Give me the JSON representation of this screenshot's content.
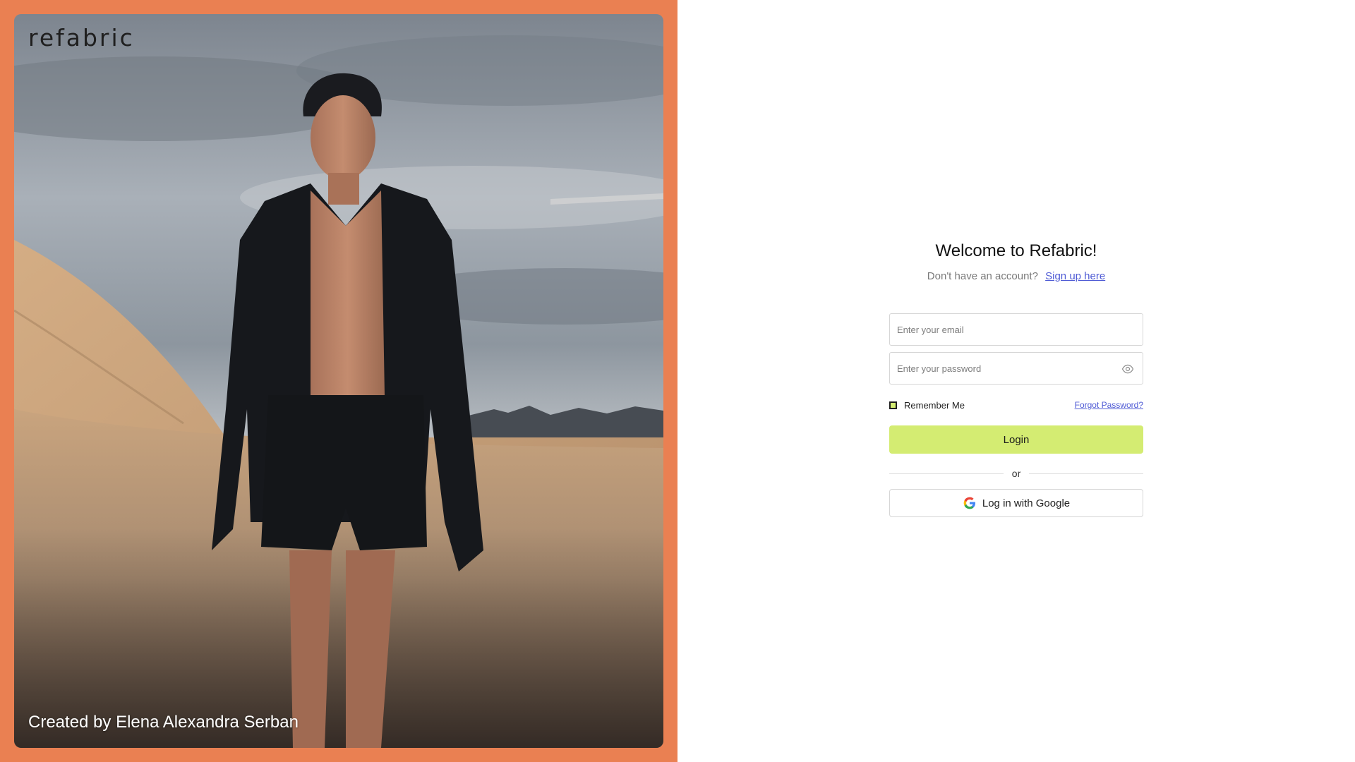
{
  "brand": {
    "logo_text": "refabric",
    "accent_color": "#ea8052",
    "button_color": "#d4ec72",
    "link_color": "#4f5bd5"
  },
  "hero": {
    "image_description": "model-in-black-hoodie-and-shorts-in-desert",
    "credit": "Created by Elena Alexandra Serban"
  },
  "login": {
    "title": "Welcome to Refabric!",
    "signup_prompt": "Don't have an account?",
    "signup_link": "Sign up here",
    "email_placeholder": "Enter your email",
    "email_value": "",
    "password_placeholder": "Enter your password",
    "password_value": "",
    "password_toggle_icon": "eye-icon",
    "remember_label": "Remember Me",
    "remember_checked": false,
    "forgot_link": "Forgot Password?",
    "login_button": "Login",
    "divider_text": "or",
    "google_button": "Log in with Google",
    "google_icon": "google-icon"
  }
}
